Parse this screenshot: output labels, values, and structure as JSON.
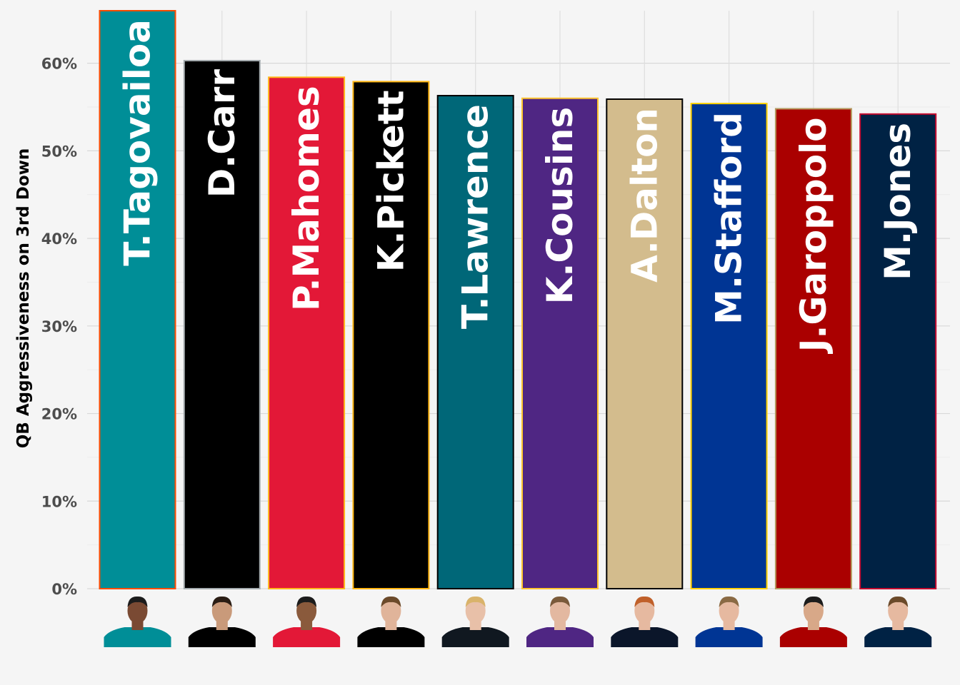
{
  "chart_data": {
    "type": "bar",
    "ylabel": "QB Aggressiveness on 3rd Down",
    "xlabel": "",
    "ylim": [
      0,
      66
    ],
    "yticks": [
      0,
      10,
      20,
      30,
      40,
      50,
      60
    ],
    "ytick_labels": [
      "0%",
      "10%",
      "20%",
      "30%",
      "40%",
      "50%",
      "60%"
    ],
    "grid": true,
    "categories": [
      "T.Tagovailoa",
      "D.Carr",
      "P.Mahomes",
      "K.Pickett",
      "T.Lawrence",
      "K.Cousins",
      "A.Dalton",
      "M.Stafford",
      "J.Garoppolo",
      "M.Jones"
    ],
    "values": [
      66.0,
      60.3,
      58.4,
      57.9,
      56.3,
      56.0,
      55.9,
      55.4,
      54.8,
      54.2
    ],
    "colors": [
      {
        "fill": "#008e97",
        "border": "#fc4c02",
        "jersey": "#008e97",
        "skin": "#7a4a33",
        "hair": "#1c1c1c"
      },
      {
        "fill": "#000000",
        "border": "#a5acaf",
        "jersey": "#000000",
        "skin": "#c99a7a",
        "hair": "#2a1d14"
      },
      {
        "fill": "#e31837",
        "border": "#ffb81c",
        "jersey": "#e31837",
        "skin": "#8a5a3c",
        "hair": "#1c1c1c"
      },
      {
        "fill": "#000000",
        "border": "#ffb612",
        "jersey": "#000000",
        "skin": "#e0b49a",
        "hair": "#6b4a2a"
      },
      {
        "fill": "#006778",
        "border": "#000000",
        "jersey": "#101820",
        "skin": "#e8c0a8",
        "hair": "#d9b36a"
      },
      {
        "fill": "#4f2683",
        "border": "#ffc62f",
        "jersey": "#4f2683",
        "skin": "#e3b8a0",
        "hair": "#7a5a3a"
      },
      {
        "fill": "#d3bc8d",
        "border": "#000000",
        "jersey": "#0b162a",
        "skin": "#e6b9a0",
        "hair": "#c0602a"
      },
      {
        "fill": "#003594",
        "border": "#ffd100",
        "jersey": "#003594",
        "skin": "#e6b9a0",
        "hair": "#8a6a44"
      },
      {
        "fill": "#aa0000",
        "border": "#b3995d",
        "jersey": "#aa0000",
        "skin": "#d8a888",
        "hair": "#1c1c1c"
      },
      {
        "fill": "#002244",
        "border": "#c60c30",
        "jersey": "#002244",
        "skin": "#e6b9a0",
        "hair": "#6b4a2a"
      }
    ],
    "icons": [
      "player-headshot-icon"
    ]
  }
}
